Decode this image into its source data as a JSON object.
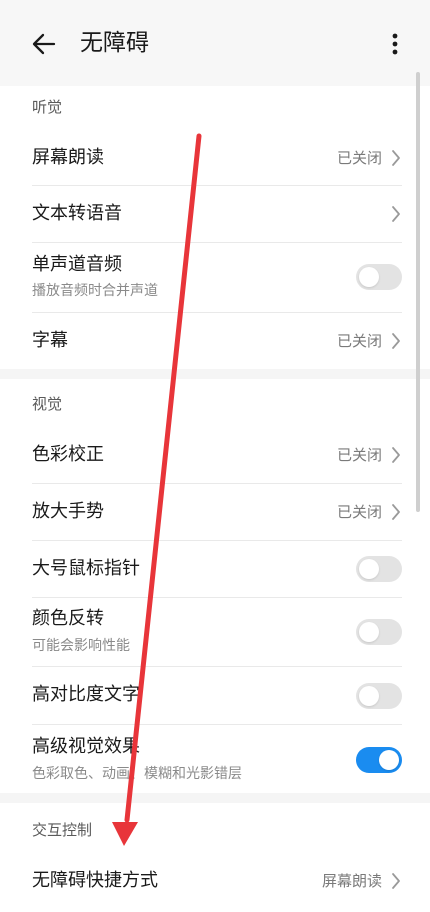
{
  "header": {
    "title": "无障碍",
    "back_icon": "arrow-left-icon",
    "more_icon": "more-vertical-icon"
  },
  "sections": {
    "hearing": {
      "header": "听觉",
      "screen_reader": {
        "label": "屏幕朗读",
        "status": "已关闭"
      },
      "tts": {
        "label": "文本转语音"
      },
      "mono_audio": {
        "label": "单声道音频",
        "subtitle": "播放音频时合并声道",
        "enabled": false
      },
      "captions": {
        "label": "字幕",
        "status": "已关闭"
      }
    },
    "vision": {
      "header": "视觉",
      "color_correction": {
        "label": "色彩校正",
        "status": "已关闭"
      },
      "magnification": {
        "label": "放大手势",
        "status": "已关闭"
      },
      "large_pointer": {
        "label": "大号鼠标指针",
        "enabled": false
      },
      "color_inversion": {
        "label": "颜色反转",
        "subtitle": "可能会影响性能",
        "enabled": false
      },
      "high_contrast_text": {
        "label": "高对比度文字",
        "enabled": false
      },
      "advanced_visual": {
        "label": "高级视觉效果",
        "subtitle": "色彩取色、动画、模糊和光影错层",
        "enabled": true
      }
    },
    "interaction": {
      "header": "交互控制",
      "shortcut": {
        "label": "无障碍快捷方式",
        "status": "屏幕朗读"
      }
    }
  },
  "colors": {
    "accent": "#1a8cf0",
    "annotation_arrow": "#e8353a"
  }
}
